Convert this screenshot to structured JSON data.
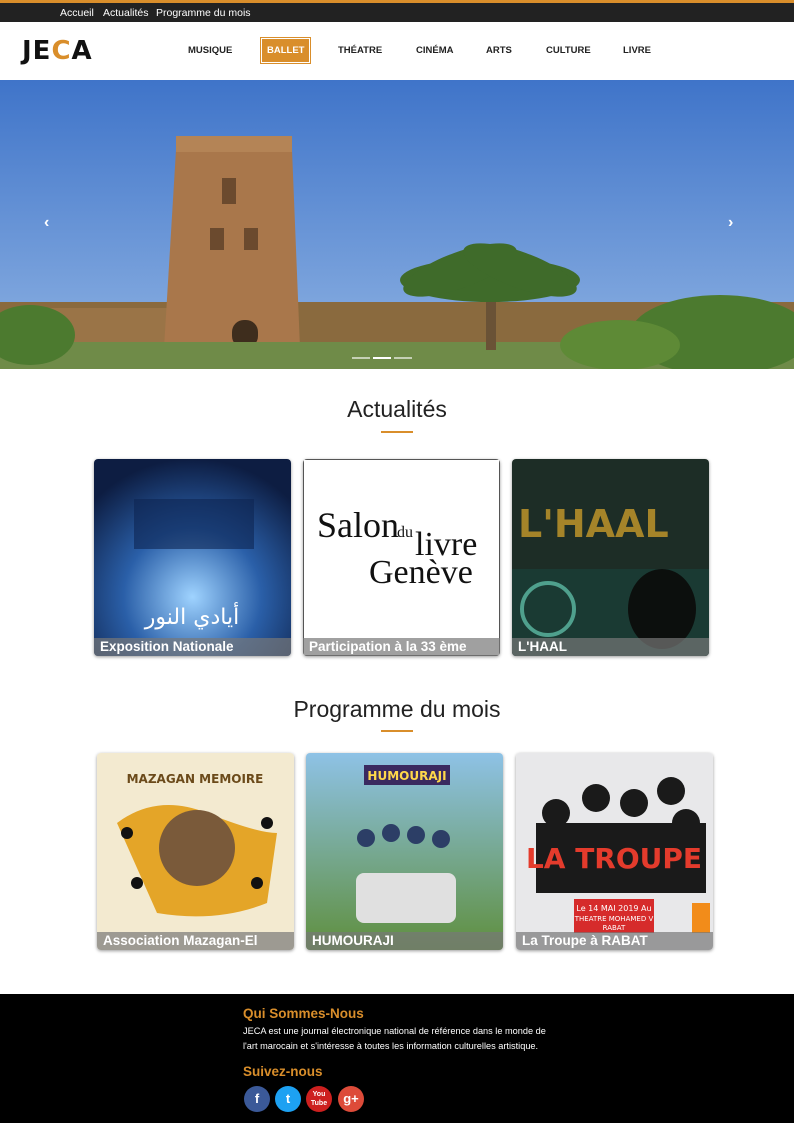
{
  "topbar": {
    "links": [
      "Accueil",
      "Actualités",
      "Programme du mois"
    ]
  },
  "logo": {
    "part1": "JE",
    "part2": "C",
    "part3": "A"
  },
  "nav": {
    "items": [
      "MUSIQUE",
      "BALLET",
      "THÉATRE",
      "CINÉMA",
      "ARTS",
      "CULTURE",
      "LIVRE"
    ],
    "active": "BALLET"
  },
  "hero": {
    "prev": "‹",
    "next": "›",
    "active_slide": 1,
    "slides": 3
  },
  "actualites": {
    "title": "Actualités",
    "cards": [
      {
        "caption": "Exposition Nationale",
        "poster_text": "أيادي النور"
      },
      {
        "caption": "Participation à la 33 ème",
        "line1": "Salon",
        "line2": "du",
        "line3": "livre",
        "line4": "Genève"
      },
      {
        "caption": "L'HAAL",
        "poster_text": "L'HAAL"
      }
    ]
  },
  "programme": {
    "title": "Programme du mois",
    "cards": [
      {
        "caption": "Association Mazagan-El",
        "poster_text": "MAZAGAN MEMOIRE"
      },
      {
        "caption": "HUMOURAJI",
        "poster_text": "HUMOURAJI"
      },
      {
        "caption": "La Troupe à RABAT",
        "poster_text": "LA TROUPE",
        "date": "Le 14 MAI 2019 Au",
        "venue": "THEATRE MOHAMED V",
        "city": "RABAT"
      }
    ]
  },
  "footer": {
    "about_title": "Qui Sommes-Nous",
    "about_line1": "JECA est une journal électronique national de référence dans le monde de",
    "about_line2": "l'art marocain et s'intéresse à toutes les information culturelles artistique.",
    "follow_title": "Suivez-nous",
    "social": [
      {
        "label": "f",
        "color": "#3b5998"
      },
      {
        "label": "t",
        "color": "#1da1f2"
      },
      {
        "label": "You Tube",
        "color": "#cd201f"
      },
      {
        "label": "g+",
        "color": "#dd4b39"
      }
    ]
  },
  "colors": {
    "accent": "#d98e2b",
    "topbar": "#222222",
    "footer": "#000000"
  }
}
